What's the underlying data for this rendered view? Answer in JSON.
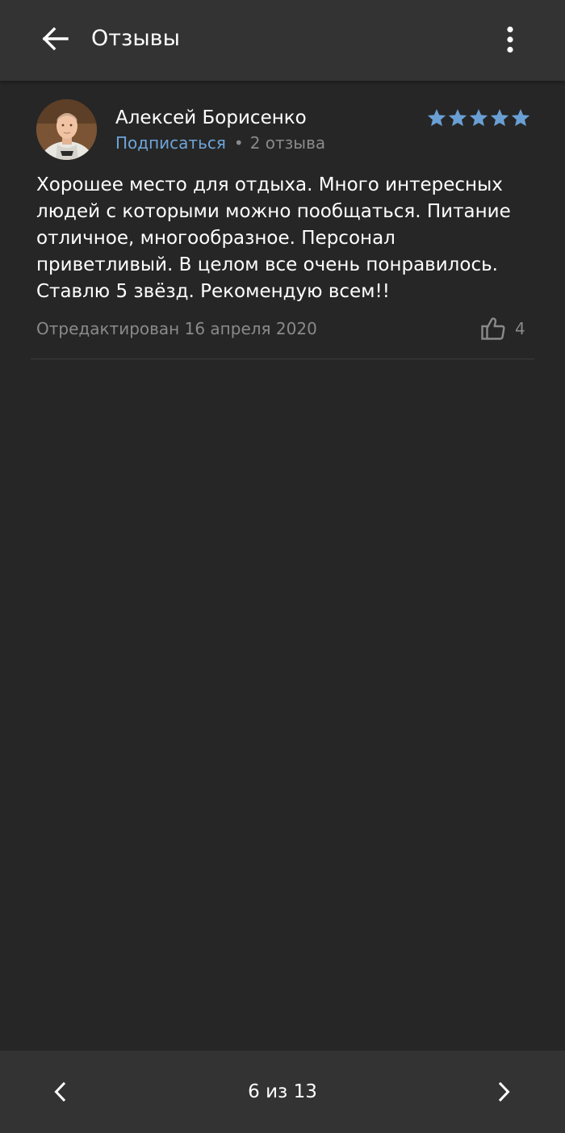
{
  "header": {
    "title": "Отзывы",
    "back_icon": "arrow-back-icon",
    "more_icon": "more-vert-icon"
  },
  "review": {
    "author": "Алексей Борисенко",
    "subscribe_label": "Подписаться",
    "separator": "•",
    "review_count": "2 отзыва",
    "rating": 5,
    "rating_max": 5,
    "text": "Хорошее место для отдыха. Много интересных людей с которыми можно пообщаться. Питание отличное, многообразное. Персонал приветливый. В целом все очень понравилось. Ставлю 5 звёзд. Рекомендую всем!!",
    "edited": "Отредактирован 16 апреля 2020",
    "likes": "4"
  },
  "pagination": {
    "label": "6 из 13",
    "prev_icon": "chevron-left-icon",
    "next_icon": "chevron-right-icon"
  },
  "colors": {
    "background": "#262626",
    "bar": "#333333",
    "accent": "#6ea4d8",
    "star": "#6a9fd4",
    "muted": "#8a8a8a"
  }
}
